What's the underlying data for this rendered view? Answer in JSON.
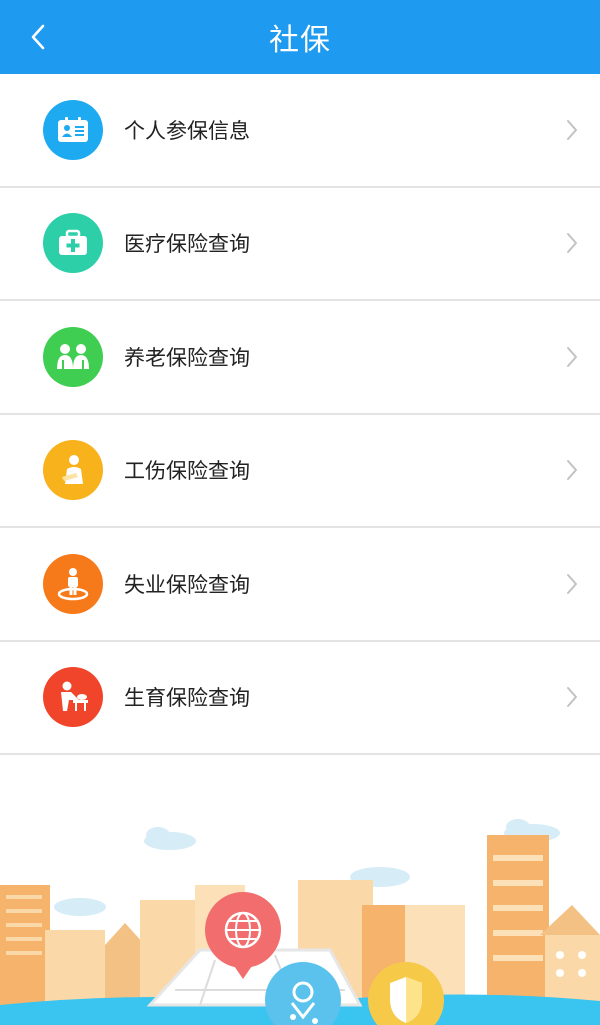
{
  "header": {
    "title": "社保",
    "back_icon": "chevron-left-icon",
    "background": "#1e9af0"
  },
  "menu": [
    {
      "label": "个人参保信息",
      "icon": "id-card-icon",
      "color": "#1eaaf0"
    },
    {
      "label": "医疗保险查询",
      "icon": "medical-kit-icon",
      "color": "#2ccfa8"
    },
    {
      "label": "养老保险查询",
      "icon": "elderly-couple-icon",
      "color": "#3fcd52"
    },
    {
      "label": "工伤保险查询",
      "icon": "injured-person-icon",
      "color": "#f7b21c"
    },
    {
      "label": "失业保险查询",
      "icon": "standing-person-icon",
      "color": "#f77a1a"
    },
    {
      "label": "生育保险查询",
      "icon": "parent-baby-icon",
      "color": "#f0452a"
    }
  ]
}
